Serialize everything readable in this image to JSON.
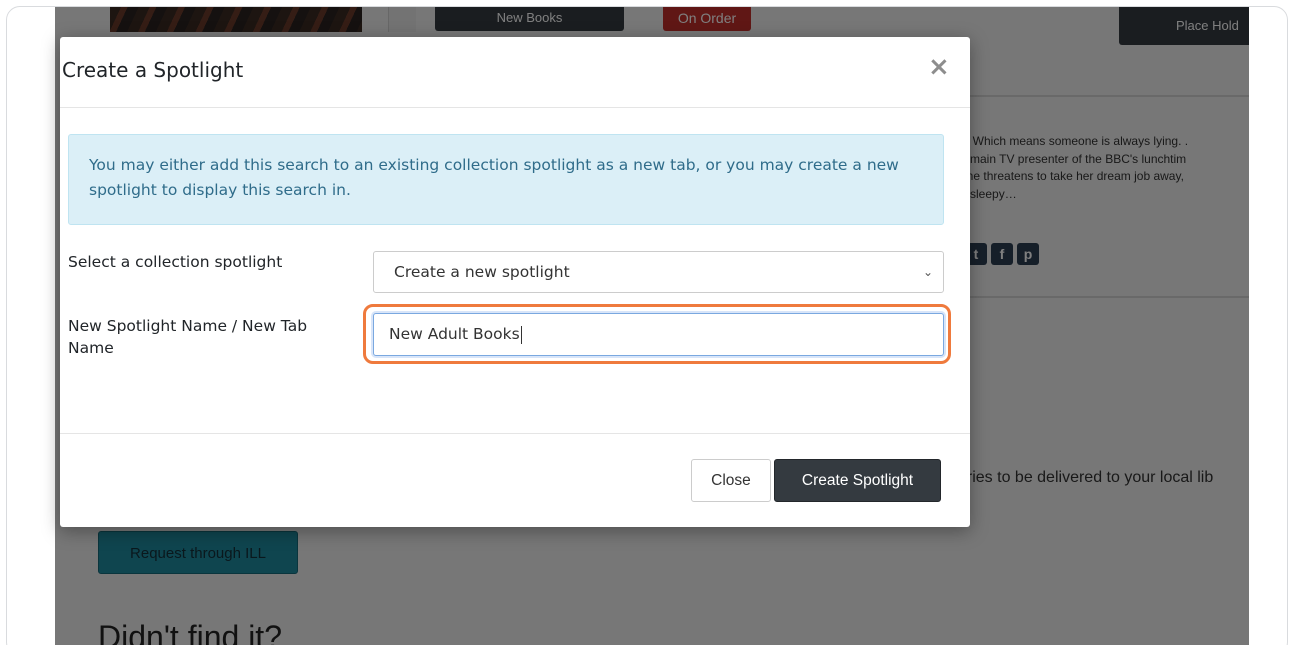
{
  "background": {
    "new_books_label": "New Books",
    "on_order_label": "On Order",
    "place_hold_label": "Place Hold",
    "description_lines": [
      "s. Which means someone is always lying. .",
      "e main TV presenter of the BBC's lunchtim",
      "one threatens to take her dream job away,",
      "e sleepy…"
    ],
    "social_icons": [
      "twitter-icon",
      "facebook-icon",
      "pinterest-icon"
    ],
    "ill_text": "aries to be delivered to your local lib",
    "ill_button_label": "Request through ILL",
    "didnt_find_heading": "Didn't find it?"
  },
  "modal": {
    "title": "Create a Spotlight",
    "close_glyph": "×",
    "info_text": "You may either add this search to an existing collection spotlight as a new tab, or you may create a new spotlight to display this search in.",
    "select_label": "Select a collection spotlight",
    "select_value": "Create a new spotlight",
    "name_label": "New Spotlight Name / New Tab Name",
    "name_value": "New Adult Books",
    "close_button_label": "Close",
    "create_button_label": "Create Spotlight"
  },
  "colors": {
    "primary_dark": "#343a40",
    "on_order_red": "#c12e2a",
    "alert_bg": "#dbeff7",
    "alert_text": "#2f6c8a",
    "highlight_ring": "#ef7a3d",
    "ill_button": "#1f8a9f"
  }
}
